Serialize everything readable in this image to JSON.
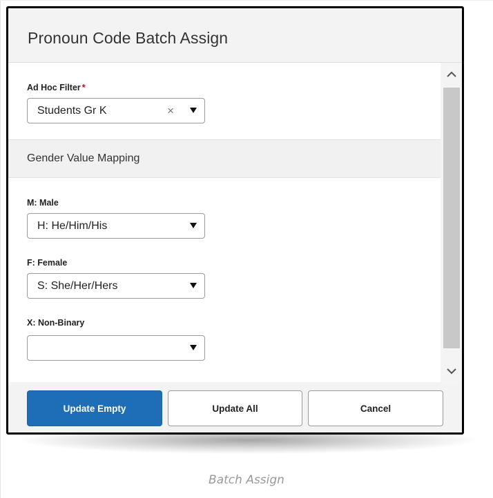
{
  "dialog": {
    "title": "Pronoun Code Batch Assign"
  },
  "ad_hoc_filter": {
    "label": "Ad Hoc Filter",
    "required_mark": "*",
    "value": "Students Gr K",
    "clear_glyph": "×"
  },
  "section": {
    "title": "Gender Value Mapping"
  },
  "mappings": [
    {
      "label": "M: Male",
      "value": "H: He/Him/His"
    },
    {
      "label": "F: Female",
      "value": "S: She/Her/Hers"
    },
    {
      "label": "X: Non-Binary",
      "value": ""
    }
  ],
  "footer": {
    "update_empty_label": "Update Empty",
    "update_all_label": "Update All",
    "cancel_label": "Cancel"
  },
  "caption": "Batch Assign",
  "icons": {
    "scroll_up": "chevron-up-icon",
    "scroll_down": "chevron-down-icon",
    "dropdown": "caret-down-icon",
    "clear": "close-icon"
  },
  "colors": {
    "primary_button": "#1e6eb7",
    "required": "#d0021b"
  }
}
